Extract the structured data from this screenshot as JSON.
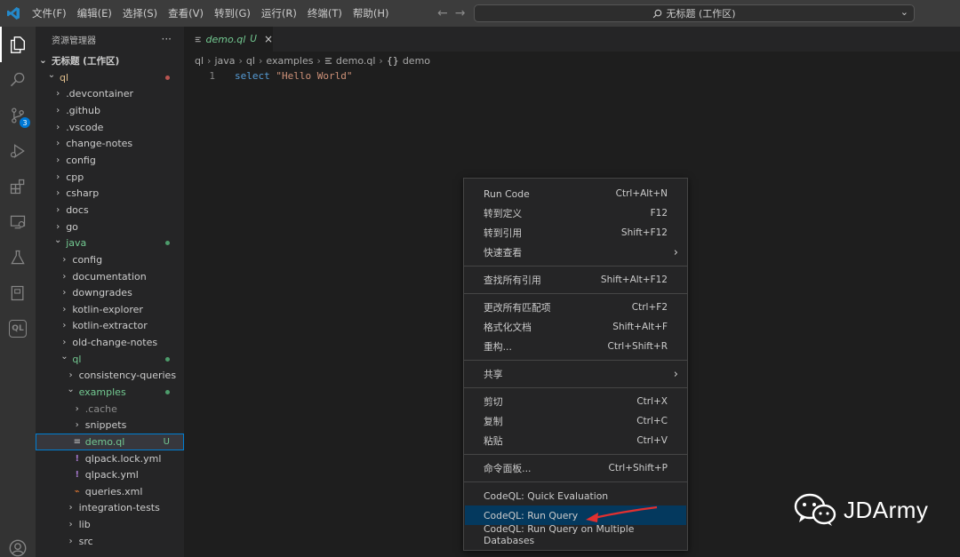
{
  "menu": [
    "文件(F)",
    "编辑(E)",
    "选择(S)",
    "查看(V)",
    "转到(G)",
    "运行(R)",
    "终端(T)",
    "帮助(H)"
  ],
  "window_title": "无标题 (工作区)",
  "activity": {
    "icons": [
      "files-icon",
      "search-icon",
      "source-control-icon",
      "run-debug-icon",
      "extensions-icon",
      "remote-explorer-icon",
      "testing-icon",
      "notebook-icon",
      "codeql-icon",
      "account-icon"
    ],
    "scm_badge": "3",
    "codeql_label": "QL"
  },
  "sidebar": {
    "title": "资源管理器",
    "more": "···",
    "workspace": "无标题 (工作区)",
    "tree": [
      {
        "label": "ql",
        "indent": 1,
        "expanded": true,
        "color": "#e2c08d",
        "dot": "#b85450"
      },
      {
        "label": ".devcontainer",
        "indent": 2,
        "expanded": false
      },
      {
        "label": ".github",
        "indent": 2,
        "expanded": false
      },
      {
        "label": ".vscode",
        "indent": 2,
        "expanded": false
      },
      {
        "label": "change-notes",
        "indent": 2,
        "expanded": false
      },
      {
        "label": "config",
        "indent": 2,
        "expanded": false
      },
      {
        "label": "cpp",
        "indent": 2,
        "expanded": false
      },
      {
        "label": "csharp",
        "indent": 2,
        "expanded": false
      },
      {
        "label": "docs",
        "indent": 2,
        "expanded": false
      },
      {
        "label": "go",
        "indent": 2,
        "expanded": false
      },
      {
        "label": "java",
        "indent": 2,
        "expanded": true,
        "color": "#73c991",
        "dot": "#4d9c6b"
      },
      {
        "label": "config",
        "indent": 3,
        "expanded": false
      },
      {
        "label": "documentation",
        "indent": 3,
        "expanded": false
      },
      {
        "label": "downgrades",
        "indent": 3,
        "expanded": false
      },
      {
        "label": "kotlin-explorer",
        "indent": 3,
        "expanded": false
      },
      {
        "label": "kotlin-extractor",
        "indent": 3,
        "expanded": false
      },
      {
        "label": "old-change-notes",
        "indent": 3,
        "expanded": false
      },
      {
        "label": "ql",
        "indent": 3,
        "expanded": true,
        "color": "#73c991",
        "dot": "#4d9c6b"
      },
      {
        "label": "consistency-queries",
        "indent": 4,
        "expanded": false
      },
      {
        "label": "examples",
        "indent": 4,
        "expanded": true,
        "color": "#73c991",
        "dot": "#4d9c6b"
      },
      {
        "label": ".cache",
        "indent": 5,
        "expanded": false,
        "color": "#8c8c8c"
      },
      {
        "label": "snippets",
        "indent": 5,
        "expanded": false
      },
      {
        "label": "demo.ql",
        "indent": 5,
        "file": "ql",
        "color": "#73c991",
        "status": "U",
        "selected": true
      },
      {
        "label": "qlpack.lock.yml",
        "indent": 5,
        "file": "yml"
      },
      {
        "label": "qlpack.yml",
        "indent": 5,
        "file": "yml"
      },
      {
        "label": "queries.xml",
        "indent": 5,
        "file": "xml"
      },
      {
        "label": "integration-tests",
        "indent": 4,
        "expanded": false
      },
      {
        "label": "lib",
        "indent": 4,
        "expanded": false
      },
      {
        "label": "src",
        "indent": 4,
        "expanded": false
      }
    ]
  },
  "editor": {
    "tab": {
      "name": "demo.ql",
      "status": "U",
      "close": "×"
    },
    "breadcrumb": [
      "ql",
      "java",
      "ql",
      "examples",
      "demo.ql",
      "demo"
    ],
    "line_number": "1",
    "code_keyword": "select",
    "code_string": "\"Hello World\""
  },
  "context_menu": {
    "groups": [
      [
        {
          "label": "Run Code",
          "shortcut": "Ctrl+Alt+N"
        },
        {
          "label": "转到定义",
          "shortcut": "F12"
        },
        {
          "label": "转到引用",
          "shortcut": "Shift+F12"
        },
        {
          "label": "快速查看",
          "shortcut": "›",
          "submenu": true
        }
      ],
      [
        {
          "label": "查找所有引用",
          "shortcut": "Shift+Alt+F12"
        }
      ],
      [
        {
          "label": "更改所有匹配项",
          "shortcut": "Ctrl+F2"
        },
        {
          "label": "格式化文档",
          "shortcut": "Shift+Alt+F"
        },
        {
          "label": "重构...",
          "shortcut": "Ctrl+Shift+R"
        }
      ],
      [
        {
          "label": "共享",
          "shortcut": "›",
          "submenu": true
        }
      ],
      [
        {
          "label": "剪切",
          "shortcut": "Ctrl+X"
        },
        {
          "label": "复制",
          "shortcut": "Ctrl+C"
        },
        {
          "label": "粘贴",
          "shortcut": "Ctrl+V"
        }
      ],
      [
        {
          "label": "命令面板...",
          "shortcut": "Ctrl+Shift+P"
        }
      ],
      [
        {
          "label": "CodeQL: Quick Evaluation",
          "shortcut": ""
        },
        {
          "label": "CodeQL: Run Query",
          "shortcut": "",
          "highlighted": true
        },
        {
          "label": "CodeQL: Run Query on Multiple Databases",
          "shortcut": ""
        }
      ]
    ]
  },
  "watermark": {
    "text": "JDArmy"
  },
  "colors": {
    "accent": "#0078d4",
    "menu_highlight": "#04395e",
    "annotation_arrow": "#e03030"
  }
}
